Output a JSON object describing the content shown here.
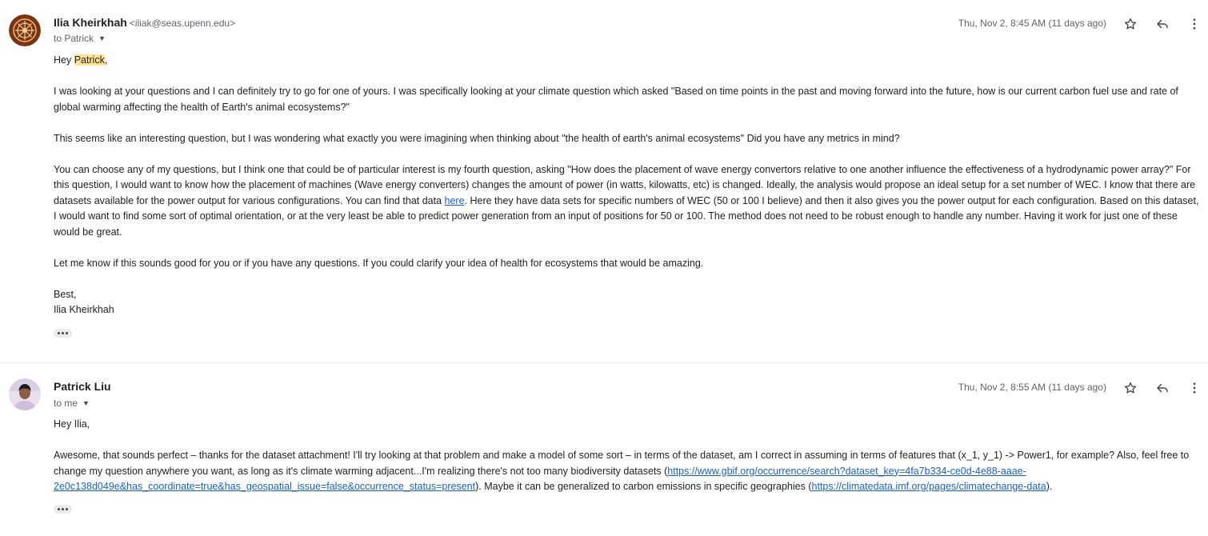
{
  "messages": [
    {
      "sender_name": "Ilia Kheirkhah",
      "sender_email": "<iliak@seas.upenn.edu>",
      "recipient": "to Patrick",
      "date": "Thu, Nov 2, 8:45 AM (11 days ago)",
      "greeting_prefix": "Hey ",
      "greeting_name": "Patrick",
      "greeting_suffix": ",",
      "para1": "I was looking at your questions and I can definitely try to go for one of yours. I was specifically looking at your climate question which asked \"Based on time points in the past and moving forward into the future, how is our current carbon fuel use and rate of global warming affecting the health of Earth's animal ecosystems?\"",
      "para2": "This seems like an interesting question, but I was wondering what exactly you were imagining when thinking about \"the health of earth's animal ecosystems\" Did you have any metrics in mind?",
      "para3_before_link": "You can choose any of my questions, but I think one that could be of particular interest is my fourth question, asking \"How does the placement of wave energy convertors relative to one another influence the effectiveness of a hydrodynamic power array?\" For this question, I would want to know how the placement of machines (Wave energy converters) changes the amount of power (in watts, kilowatts, etc) is changed. Ideally, the analysis would propose an ideal setup for a set number of WEC. I know that there are datasets available for the power output for various configurations. You can find that data ",
      "para3_link": "here",
      "para3_after_link": ". Here they have data sets for specific numbers of WEC (50 or 100 I believe) and then it also gives you the power output for each configuration. Based on this dataset, I would want to find some sort of optimal orientation, or at the very least be able to predict power generation from an input of positions for 50 or 100. The method does not need to be robust enough to handle any number. Having it work for just one of these would be great.",
      "para4": "Let me know if this sounds good for you or if you have any questions. If you could clarify your idea of health for ecosystems that would be amazing.",
      "signoff": "Best,",
      "signature": "Ilia Kheirkhah"
    },
    {
      "sender_name": "Patrick Liu",
      "recipient": "to me",
      "date": "Thu, Nov 2, 8:55 AM (11 days ago)",
      "greeting": "Hey Ilia,",
      "para1_before_link1": "Awesome, that sounds perfect – thanks for the dataset attachment! I'll try looking at that problem and make a model of some sort – in terms of the dataset, am I correct in assuming in terms of features that (x_1, y_1) -> Power1, for example? Also, feel free to change my question anywhere you want, as long as it's climate warming adjacent...I'm realizing there's not too many biodiversity datasets (",
      "link1": "https://www.gbif.org/occurrence/search?dataset_key=4fa7b334-ce0d-4e88-aaae-2e0c138d049e&has_coordinate=true&has_geospatial_issue=false&occurrence_status=present",
      "para1_between_links": "). Maybe it can be generalized to carbon emissions in specific geographies (",
      "link2": "https://climatedata.imf.org/pages/climatechange-data",
      "para1_after_link2": ")."
    }
  ],
  "icons": {
    "star": "star-icon",
    "reply": "reply-icon",
    "more": "more-vert-icon",
    "expand": "ellipsis-icon"
  },
  "colors": {
    "highlight": "#fde293",
    "link": "#1a5fcc",
    "avatar1_bg": "#7a3412"
  }
}
